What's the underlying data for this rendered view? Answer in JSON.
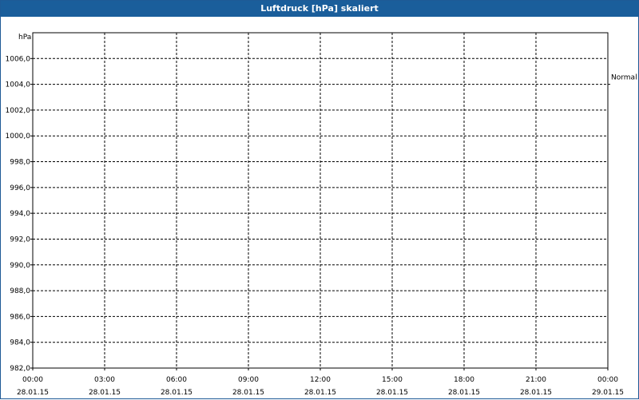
{
  "window": {
    "title": "Luftdruck [hPa] skaliert",
    "title_bar_color": "#1a5e9b"
  },
  "chart_data": {
    "type": "line",
    "title": "Luftdruck [hPa] skaliert",
    "ylabel": "hPa",
    "xlabel": "",
    "ylim": [
      982,
      1008
    ],
    "y_ticks": [
      982,
      984,
      986,
      988,
      990,
      992,
      994,
      996,
      998,
      1000,
      1002,
      1004,
      1006
    ],
    "y_tick_labels": [
      "982,0",
      "984,0",
      "986,0",
      "988,0",
      "990,0",
      "992,0",
      "994,0",
      "996,0",
      "998,0",
      "1000,0",
      "1002,0",
      "1004,0",
      "1006,0"
    ],
    "x_ticks": [
      {
        "time": "00:00",
        "date": "28.01.15"
      },
      {
        "time": "03:00",
        "date": "28.01.15"
      },
      {
        "time": "06:00",
        "date": "28.01.15"
      },
      {
        "time": "09:00",
        "date": "28.01.15"
      },
      {
        "time": "12:00",
        "date": "28.01.15"
      },
      {
        "time": "15:00",
        "date": "28.01.15"
      },
      {
        "time": "18:00",
        "date": "28.01.15"
      },
      {
        "time": "21:00",
        "date": "28.01.15"
      },
      {
        "time": "00:00",
        "date": "29.01.15"
      }
    ],
    "grid": true,
    "reference_lines": [
      {
        "label": "Normal",
        "y": 1004.0
      }
    ],
    "series": []
  }
}
